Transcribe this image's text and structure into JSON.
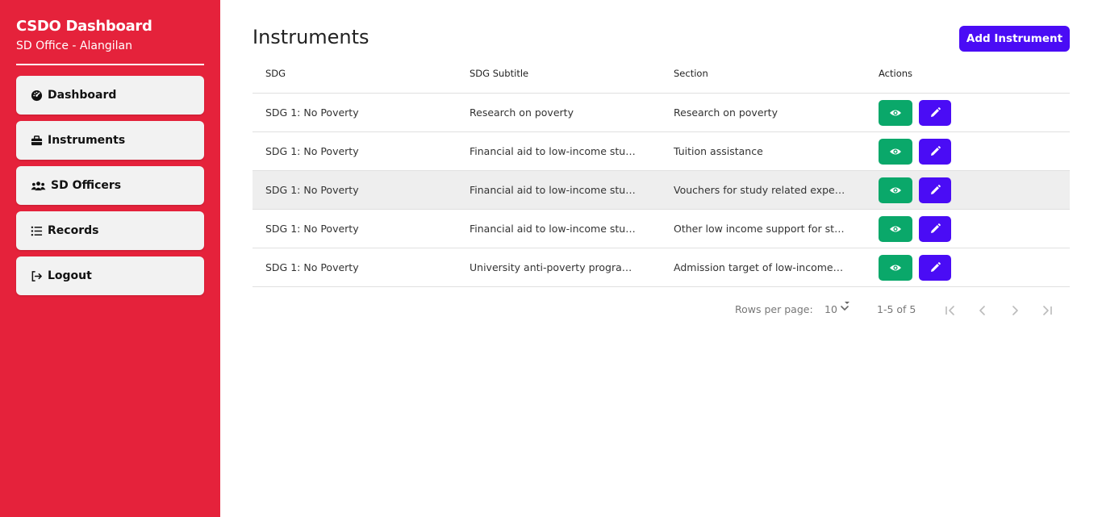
{
  "sidebar": {
    "title": "CSDO Dashboard",
    "subtitle": "SD Office - Alangilan",
    "items": [
      {
        "label": "Dashboard",
        "icon": "speedometer-icon"
      },
      {
        "label": "Instruments",
        "icon": "toolbox-icon"
      },
      {
        "label": "SD Officers",
        "icon": "users-icon"
      },
      {
        "label": "Records",
        "icon": "list-icon"
      },
      {
        "label": "Logout",
        "icon": "logout-icon"
      }
    ]
  },
  "main": {
    "title": "Instruments",
    "add_button": "Add Instrument"
  },
  "table": {
    "headers": [
      "SDG",
      "SDG Subtitle",
      "Section",
      "Actions"
    ],
    "rows": [
      {
        "sdg": "SDG 1: No Poverty",
        "subtitle": "Research on poverty",
        "section": "Research on poverty"
      },
      {
        "sdg": "SDG 1: No Poverty",
        "subtitle": "Financial aid to low-income stud…",
        "section": "Tuition assistance"
      },
      {
        "sdg": "SDG 1: No Poverty",
        "subtitle": "Financial aid to low-income stud…",
        "section": "Vouchers for study related expe…"
      },
      {
        "sdg": "SDG 1: No Poverty",
        "subtitle": "Financial aid to low-income stud…",
        "section": "Other low income support for stu…"
      },
      {
        "sdg": "SDG 1: No Poverty",
        "subtitle": "University anti-poverty program…",
        "section": "Admission target of low-income …"
      }
    ]
  },
  "pagination": {
    "rows_per_page_label": "Rows per page:",
    "rows_per_page_value": "10",
    "range": "1-5 of 5"
  },
  "colors": {
    "sidebar": "#e5223b",
    "primary": "#4a0cf5",
    "view": "#0aa86a"
  }
}
